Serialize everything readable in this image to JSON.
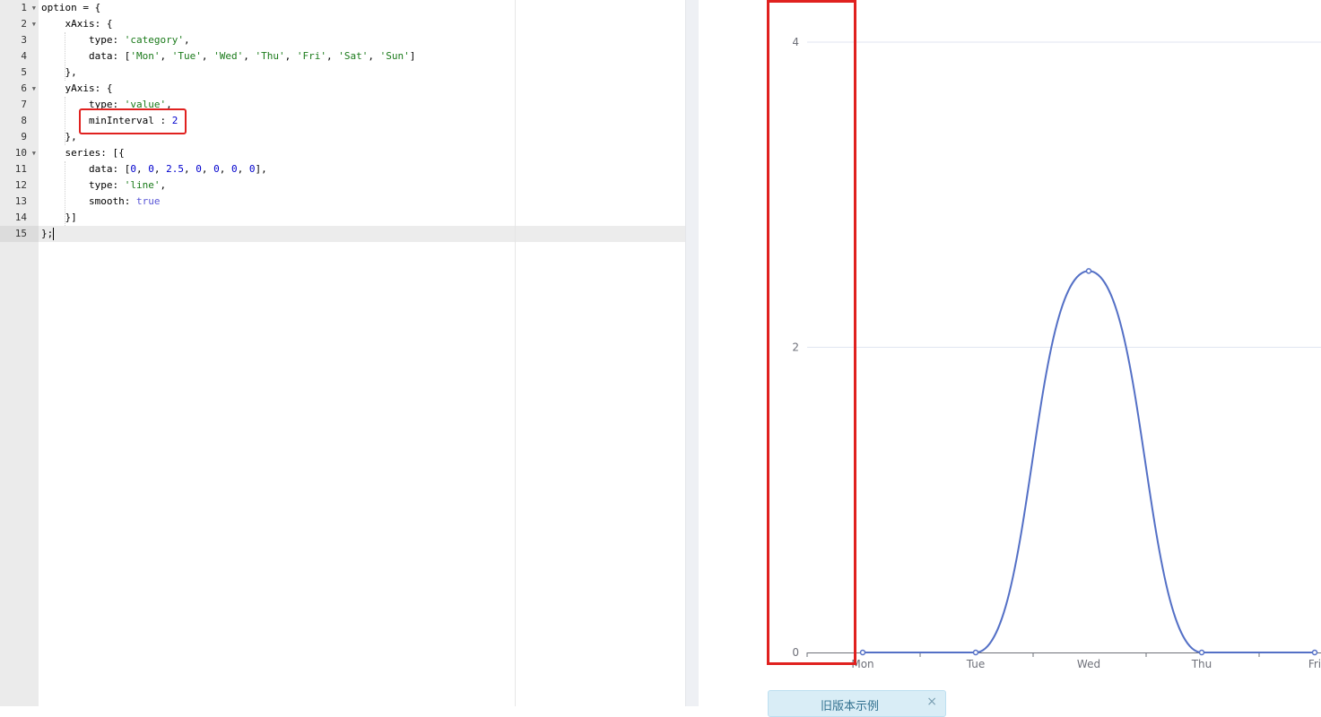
{
  "editor": {
    "line_numbers": [
      "1",
      "2",
      "3",
      "4",
      "5",
      "6",
      "7",
      "8",
      "9",
      "10",
      "11",
      "12",
      "13",
      "14",
      "15"
    ],
    "fold_lines": [
      1,
      2,
      6,
      10
    ],
    "active_line": 15,
    "lines": [
      [
        {
          "t": "plain",
          "v": "option = {"
        }
      ],
      [
        {
          "t": "plain",
          "v": "    xAxis: {"
        }
      ],
      [
        {
          "t": "plain",
          "v": "        type: "
        },
        {
          "t": "str",
          "v": "'category'"
        },
        {
          "t": "plain",
          "v": ","
        }
      ],
      [
        {
          "t": "plain",
          "v": "        data: ["
        },
        {
          "t": "str",
          "v": "'Mon'"
        },
        {
          "t": "plain",
          "v": ", "
        },
        {
          "t": "str",
          "v": "'Tue'"
        },
        {
          "t": "plain",
          "v": ", "
        },
        {
          "t": "str",
          "v": "'Wed'"
        },
        {
          "t": "plain",
          "v": ", "
        },
        {
          "t": "str",
          "v": "'Thu'"
        },
        {
          "t": "plain",
          "v": ", "
        },
        {
          "t": "str",
          "v": "'Fri'"
        },
        {
          "t": "plain",
          "v": ", "
        },
        {
          "t": "str",
          "v": "'Sat'"
        },
        {
          "t": "plain",
          "v": ", "
        },
        {
          "t": "str",
          "v": "'Sun'"
        },
        {
          "t": "plain",
          "v": "]"
        }
      ],
      [
        {
          "t": "plain",
          "v": "    },"
        }
      ],
      [
        {
          "t": "plain",
          "v": "    yAxis: {"
        }
      ],
      [
        {
          "t": "plain",
          "v": "        type: "
        },
        {
          "t": "str",
          "v": "'value'"
        },
        {
          "t": "plain",
          "v": ","
        }
      ],
      [
        {
          "t": "plain",
          "v": "        minInterval : "
        },
        {
          "t": "num",
          "v": "2"
        }
      ],
      [
        {
          "t": "plain",
          "v": "    },"
        }
      ],
      [
        {
          "t": "plain",
          "v": "    series: [{"
        }
      ],
      [
        {
          "t": "plain",
          "v": "        data: ["
        },
        {
          "t": "num",
          "v": "0"
        },
        {
          "t": "plain",
          "v": ", "
        },
        {
          "t": "num",
          "v": "0"
        },
        {
          "t": "plain",
          "v": ", "
        },
        {
          "t": "num",
          "v": "2.5"
        },
        {
          "t": "plain",
          "v": ", "
        },
        {
          "t": "num",
          "v": "0"
        },
        {
          "t": "plain",
          "v": ", "
        },
        {
          "t": "num",
          "v": "0"
        },
        {
          "t": "plain",
          "v": ", "
        },
        {
          "t": "num",
          "v": "0"
        },
        {
          "t": "plain",
          "v": ", "
        },
        {
          "t": "num",
          "v": "0"
        },
        {
          "t": "plain",
          "v": "],"
        }
      ],
      [
        {
          "t": "plain",
          "v": "        type: "
        },
        {
          "t": "str",
          "v": "'line'"
        },
        {
          "t": "plain",
          "v": ","
        }
      ],
      [
        {
          "t": "plain",
          "v": "        smooth: "
        },
        {
          "t": "bool",
          "v": "true"
        }
      ],
      [
        {
          "t": "plain",
          "v": "    }]"
        }
      ],
      [
        {
          "t": "plain",
          "v": "};"
        }
      ]
    ]
  },
  "chart_data": {
    "type": "line",
    "categories": [
      "Mon",
      "Tue",
      "Wed",
      "Thu",
      "Fri"
    ],
    "series": [
      {
        "values": [
          0,
          0,
          2.5,
          0,
          0
        ],
        "smooth": true,
        "color": "#5470c6"
      }
    ],
    "yticks": [
      "0",
      "2",
      "4"
    ],
    "ylim": [
      0,
      4
    ],
    "grid": true,
    "axis_color": "#6e7079",
    "grid_color": "#e0e6f1"
  },
  "colors": {
    "highlight": "#e0211f",
    "string": "#1a7a1a",
    "number": "#0000cd",
    "boolean": "#5855d6"
  },
  "notice": {
    "text": "旧版本示例",
    "close_icon": "close-icon"
  }
}
